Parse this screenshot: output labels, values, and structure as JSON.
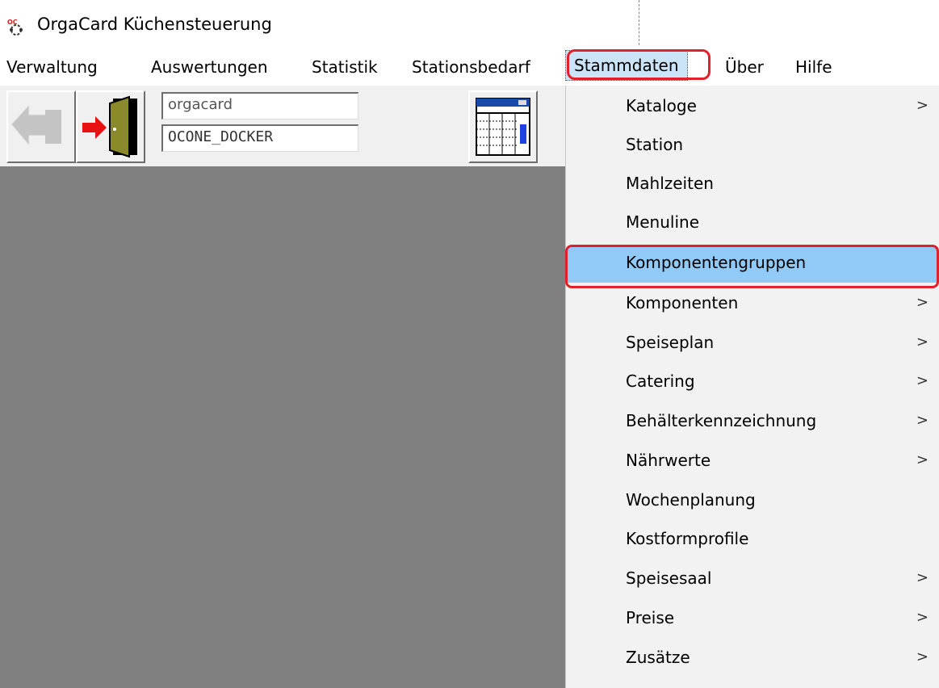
{
  "window": {
    "title": "OrgaCard Küchensteuerung",
    "icon": "orgacard-logo-icon"
  },
  "menubar": {
    "items": [
      {
        "label": "Verwaltung"
      },
      {
        "label": "Auswertungen"
      },
      {
        "label": "Statistik"
      },
      {
        "label": "Stationsbedarf"
      },
      {
        "label": "Stammdaten",
        "active": true
      },
      {
        "label": "Über"
      },
      {
        "label": "Hilfe"
      }
    ]
  },
  "toolbar": {
    "back_icon": "back-arrow-icon",
    "logout_icon": "exit-door-icon",
    "user_field": "orgacard",
    "db_field": "OCONE_DOCKER",
    "grid_icon": "table-window-icon"
  },
  "dropdown": {
    "items": [
      {
        "label": "Kataloge",
        "submenu": true
      },
      {
        "label": "Station",
        "submenu": false
      },
      {
        "label": "Mahlzeiten",
        "submenu": false
      },
      {
        "label": "Menuline",
        "submenu": false
      },
      {
        "label": "Komponentengruppen",
        "submenu": false,
        "selected": true
      },
      {
        "label": "Komponenten",
        "submenu": true
      },
      {
        "label": "Speiseplan",
        "submenu": true
      },
      {
        "label": "Catering",
        "submenu": true
      },
      {
        "label": "Behälterkennzeichnung",
        "submenu": true
      },
      {
        "label": "Nährwerte",
        "submenu": true
      },
      {
        "label": "Wochenplanung",
        "submenu": false
      },
      {
        "label": "Kostformprofile",
        "submenu": false
      },
      {
        "label": "Speisesaal",
        "submenu": true
      },
      {
        "label": "Preise",
        "submenu": true
      },
      {
        "label": "Zusätze",
        "submenu": true
      }
    ],
    "submenu_arrow": ">"
  },
  "colors": {
    "accent_highlight": "#e0202a",
    "selection": "#91c9f7",
    "workspace": "#808080"
  }
}
